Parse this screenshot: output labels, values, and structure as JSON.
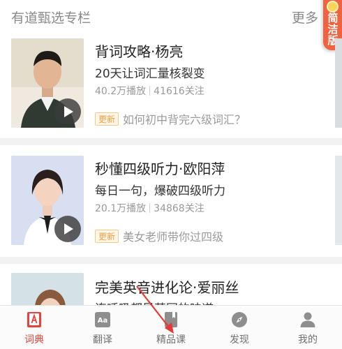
{
  "section": {
    "title": "有道甄选专栏",
    "more": "更多"
  },
  "simple_mode": {
    "label": "简洁版"
  },
  "courses": [
    {
      "title": "背词攻略·杨亮",
      "subtitle": "20天让词汇量核裂变",
      "plays": "40.2万播放",
      "follows": "41616关注",
      "badge": "更新",
      "update": "如何初中背完六级词汇？"
    },
    {
      "title": "秒懂四级听力·欧阳萍",
      "subtitle": "每日一句，爆破四级听力",
      "plays": "20.1万播放",
      "follows": "34868关注",
      "badge": "更新",
      "update": "美女老师带你过四级"
    },
    {
      "title": "完美英音进化论·爱丽丝",
      "subtitle": "连呼吸都是英国的味道"
    }
  ],
  "nav": [
    {
      "label": "词典",
      "icon": "dictionary-icon",
      "active": true
    },
    {
      "label": "翻译",
      "icon": "translate-icon",
      "active": false
    },
    {
      "label": "精品课",
      "icon": "course-book-icon",
      "active": false
    },
    {
      "label": "发现",
      "icon": "compass-icon",
      "active": false
    },
    {
      "label": "我的",
      "icon": "person-icon",
      "active": false
    }
  ],
  "colors": {
    "accent": "#e8423a",
    "simple_tab": "#ef6340",
    "badge": "#f0a040",
    "arrow": "#e53935"
  }
}
